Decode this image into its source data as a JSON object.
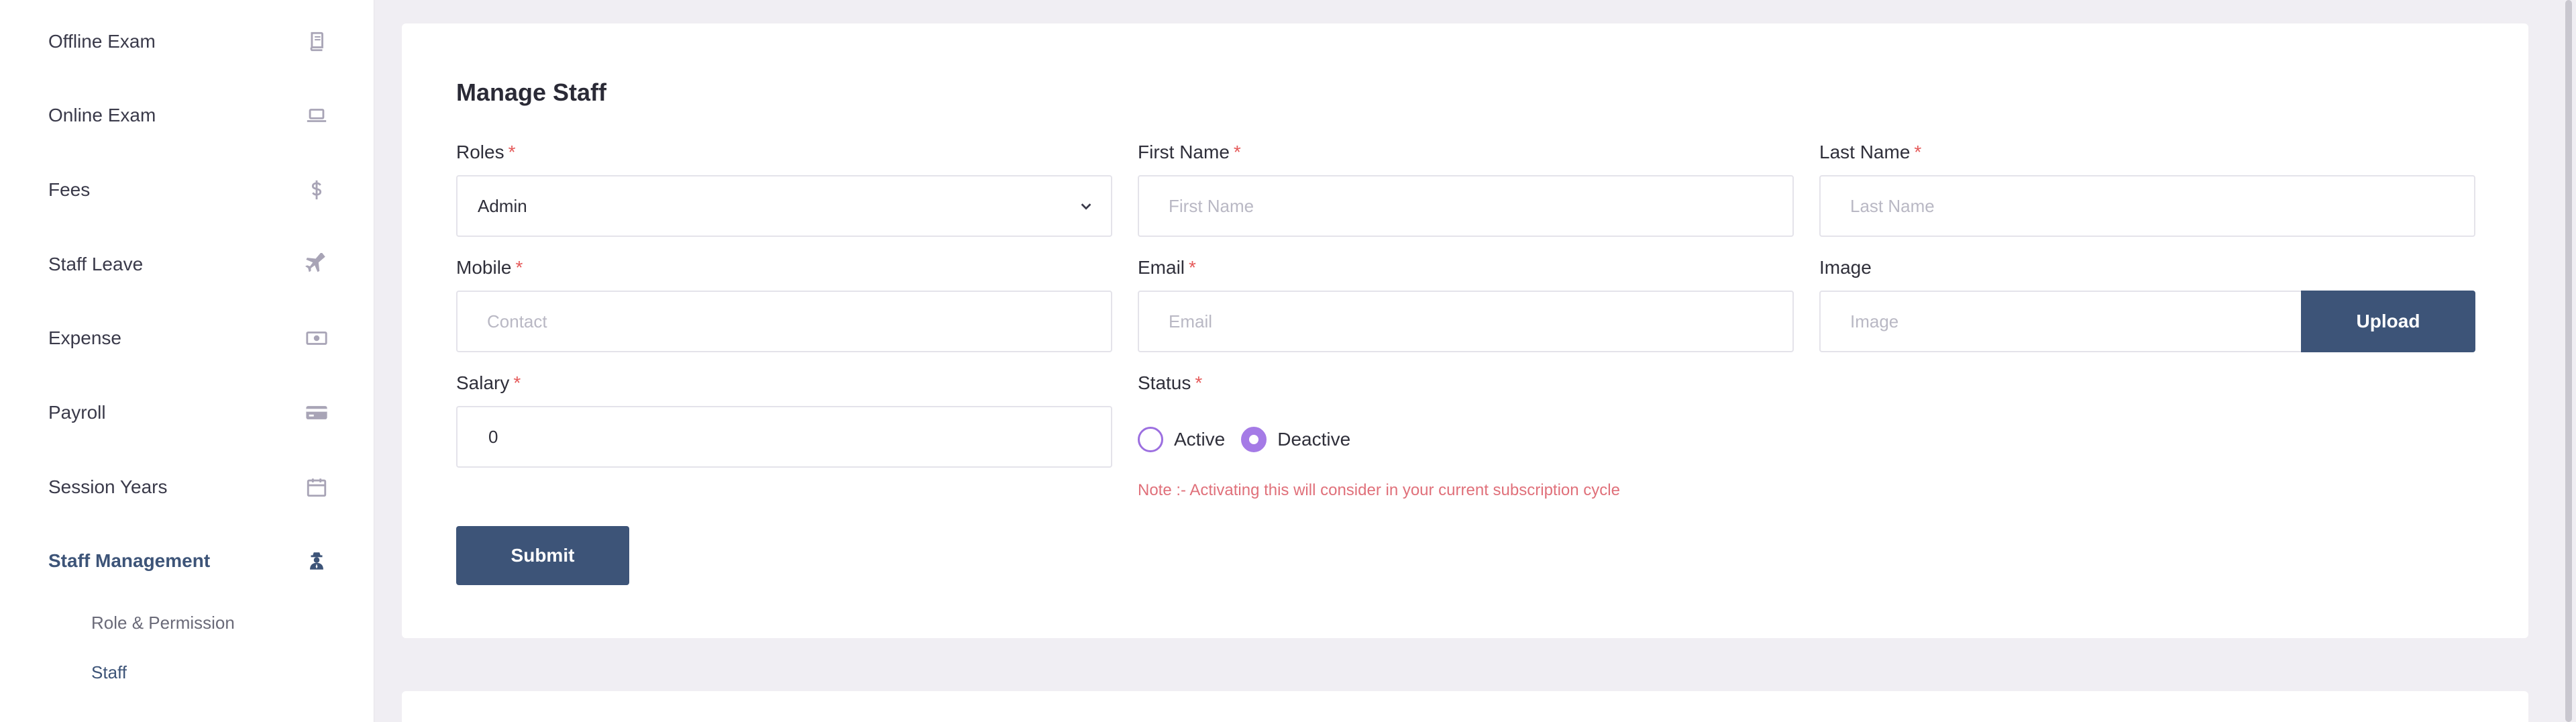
{
  "sidebar": {
    "items": [
      {
        "label": "Offline Exam",
        "icon": "book-icon"
      },
      {
        "label": "Online Exam",
        "icon": "laptop-icon"
      },
      {
        "label": "Fees",
        "icon": "dollar-icon"
      },
      {
        "label": "Staff Leave",
        "icon": "plane-icon"
      },
      {
        "label": "Expense",
        "icon": "money-icon"
      },
      {
        "label": "Payroll",
        "icon": "credit-card-icon"
      },
      {
        "label": "Session Years",
        "icon": "calendar-icon"
      },
      {
        "label": "Staff Management",
        "icon": "user-secret-icon"
      }
    ],
    "sub_items": [
      {
        "label": "Role & Permission"
      },
      {
        "label": "Staff"
      }
    ]
  },
  "form": {
    "title": "Manage Staff",
    "required_mark": "*",
    "roles": {
      "label": "Roles",
      "value": "Admin"
    },
    "first_name": {
      "label": "First Name",
      "placeholder": "First Name"
    },
    "last_name": {
      "label": "Last Name",
      "placeholder": "Last Name"
    },
    "mobile": {
      "label": "Mobile",
      "placeholder": "Contact"
    },
    "email": {
      "label": "Email",
      "placeholder": "Email"
    },
    "image": {
      "label": "Image",
      "placeholder": "Image",
      "button": "Upload"
    },
    "salary": {
      "label": "Salary",
      "value": "0"
    },
    "status": {
      "label": "Status",
      "options": [
        {
          "label": "Active",
          "checked": false
        },
        {
          "label": "Deactive",
          "checked": true
        }
      ],
      "note": "Note :- Activating this will consider in your current subscription cycle"
    },
    "submit": "Submit"
  },
  "colors": {
    "accent": "#3d5478",
    "radio": "#a57be6",
    "required": "#e55a5a",
    "note": "#e0707a",
    "background": "#f0eef3"
  }
}
